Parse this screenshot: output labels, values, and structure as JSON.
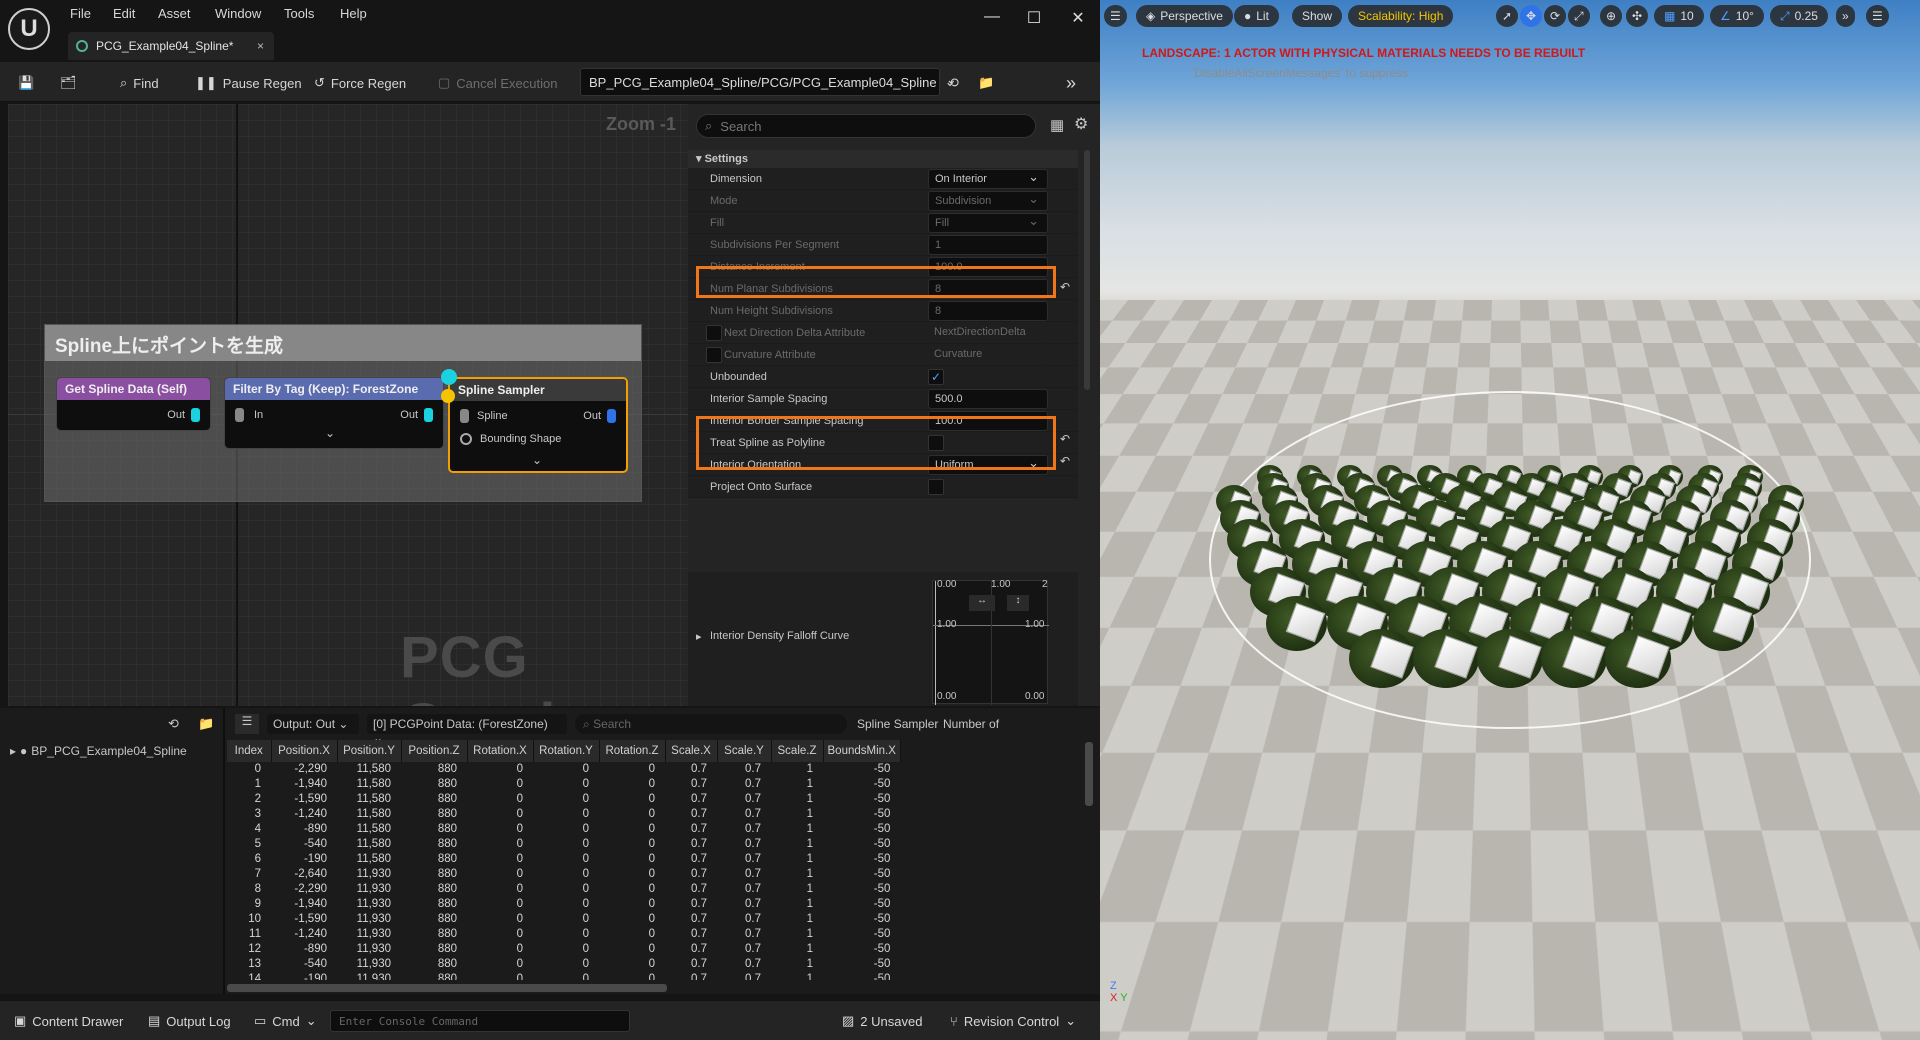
{
  "menu": [
    "File",
    "Edit",
    "Asset",
    "Window",
    "Tools",
    "Help"
  ],
  "doc_tab": {
    "title": "PCG_Example04_Spline*",
    "close": "×"
  },
  "toolbar": {
    "find": "Find",
    "pause_regen": "Pause Regen",
    "force_regen": "Force Regen",
    "cancel_execution": "Cancel Execution",
    "graph_path": "BP_PCG_Example04_Spline/PCG/PCG_Example04_Spline"
  },
  "graph": {
    "zoom": "Zoom -1",
    "watermark": "PCG Graph",
    "comment_title": "Spline上にポイントを生成",
    "nodes": {
      "get_spline": {
        "title": "Get Spline Data (Self)",
        "out": "Out",
        "color": "#8a4fa0"
      },
      "filter": {
        "title": "Filter By Tag (Keep): ForestZone",
        "in": "In",
        "out": "Out",
        "color": "#5b6bb0"
      },
      "sampler": {
        "title": "Spline Sampler",
        "spline": "Spline",
        "bounding": "Bounding Shape",
        "out": "Out",
        "color": "#3a3a3a"
      }
    }
  },
  "details": {
    "search_placeholder": "Search",
    "section": "Settings",
    "rows": [
      {
        "label": "Dimension",
        "value": "On Interior",
        "type": "combo",
        "dim": false
      },
      {
        "label": "Mode",
        "value": "Subdivision",
        "type": "combo",
        "dim": true
      },
      {
        "label": "Fill",
        "value": "Fill",
        "type": "combo",
        "dim": true
      },
      {
        "label": "Subdivisions Per Segment",
        "value": "1",
        "type": "text",
        "dim": true
      },
      {
        "label": "Distance Increment",
        "value": "100.0",
        "type": "text",
        "dim": true
      },
      {
        "label": "Num Planar Subdivisions",
        "value": "8",
        "type": "text",
        "dim": true
      },
      {
        "label": "Num Height Subdivisions",
        "value": "8",
        "type": "text",
        "dim": true
      },
      {
        "label": "Next Direction Delta Attribute",
        "value": "NextDirectionDelta",
        "type": "checktext",
        "dim": true
      },
      {
        "label": "Curvature Attribute",
        "value": "Curvature",
        "type": "checktext",
        "dim": true
      },
      {
        "label": "Unbounded",
        "value": "",
        "type": "check-on",
        "dim": false
      },
      {
        "label": "Interior Sample Spacing",
        "value": "500.0",
        "type": "text",
        "dim": false
      },
      {
        "label": "Interior Border Sample Spacing",
        "value": "100.0",
        "type": "text",
        "dim": false
      },
      {
        "label": "Treat Spline as Polyline",
        "value": "",
        "type": "check",
        "dim": false
      },
      {
        "label": "Interior Orientation",
        "value": "Uniform",
        "type": "combo",
        "dim": false
      },
      {
        "label": "Project Onto Surface",
        "value": "",
        "type": "check",
        "dim": false
      }
    ],
    "curve": {
      "label": "Interior Density Falloff Curve",
      "x0": "0.00",
      "x1": "1.00",
      "x2": "2",
      "y_top_left": "1.00",
      "y_top_right": "1.00",
      "y_bottom_left": "0.00",
      "y_bottom_right": "0.00"
    }
  },
  "outline": {
    "item": "BP_PCG_Example04_Spline"
  },
  "data_view": {
    "output": "Output: Out",
    "data": "[0] PCGPoint Data: (ForestZone)",
    "search_placeholder": "Search",
    "node_label": "Spline Sampler",
    "count_label": "Number of",
    "columns": [
      "Index",
      "Position.X",
      "Position.Y",
      "Position.Z",
      "Rotation.X",
      "Rotation.Y",
      "Rotation.Z",
      "Scale.X",
      "Scale.Y",
      "Scale.Z",
      "BoundsMin.X"
    ],
    "rows": [
      [
        "0",
        "-2,290",
        "11,580",
        "880",
        "0",
        "0",
        "0",
        "0.7",
        "0.7",
        "1",
        "-50"
      ],
      [
        "1",
        "-1,940",
        "11,580",
        "880",
        "0",
        "0",
        "0",
        "0.7",
        "0.7",
        "1",
        "-50"
      ],
      [
        "2",
        "-1,590",
        "11,580",
        "880",
        "0",
        "0",
        "0",
        "0.7",
        "0.7",
        "1",
        "-50"
      ],
      [
        "3",
        "-1,240",
        "11,580",
        "880",
        "0",
        "0",
        "0",
        "0.7",
        "0.7",
        "1",
        "-50"
      ],
      [
        "4",
        "-890",
        "11,580",
        "880",
        "0",
        "0",
        "0",
        "0.7",
        "0.7",
        "1",
        "-50"
      ],
      [
        "5",
        "-540",
        "11,580",
        "880",
        "0",
        "0",
        "0",
        "0.7",
        "0.7",
        "1",
        "-50"
      ],
      [
        "6",
        "-190",
        "11,580",
        "880",
        "0",
        "0",
        "0",
        "0.7",
        "0.7",
        "1",
        "-50"
      ],
      [
        "7",
        "-2,640",
        "11,930",
        "880",
        "0",
        "0",
        "0",
        "0.7",
        "0.7",
        "1",
        "-50"
      ],
      [
        "8",
        "-2,290",
        "11,930",
        "880",
        "0",
        "0",
        "0",
        "0.7",
        "0.7",
        "1",
        "-50"
      ],
      [
        "9",
        "-1,940",
        "11,930",
        "880",
        "0",
        "0",
        "0",
        "0.7",
        "0.7",
        "1",
        "-50"
      ],
      [
        "10",
        "-1,590",
        "11,930",
        "880",
        "0",
        "0",
        "0",
        "0.7",
        "0.7",
        "1",
        "-50"
      ],
      [
        "11",
        "-1,240",
        "11,930",
        "880",
        "0",
        "0",
        "0",
        "0.7",
        "0.7",
        "1",
        "-50"
      ],
      [
        "12",
        "-890",
        "11,930",
        "880",
        "0",
        "0",
        "0",
        "0.7",
        "0.7",
        "1",
        "-50"
      ],
      [
        "13",
        "-540",
        "11,930",
        "880",
        "0",
        "0",
        "0",
        "0.7",
        "0.7",
        "1",
        "-50"
      ],
      [
        "14",
        "-190",
        "11,930",
        "880",
        "0",
        "0",
        "0",
        "0.7",
        "0.7",
        "1",
        "-50"
      ]
    ]
  },
  "statusbar": {
    "content_drawer": "Content Drawer",
    "output_log": "Output Log",
    "cmd": "Cmd",
    "console_placeholder": "Enter Console Command",
    "unsaved": "2 Unsaved",
    "revision_control": "Revision Control"
  },
  "viewport": {
    "perspective": "Perspective",
    "lit": "Lit",
    "show": "Show",
    "scalability": "Scalability: High",
    "grid": "10",
    "angle": "10°",
    "scale": "0.25",
    "warning": "LANDSCAPE: 1 ACTOR WITH PHYSICAL MATERIALS NEEDS TO BE REBUILT",
    "suppress": "'DisableAllScreenMessages' to suppress"
  },
  "colors": {
    "highlight": "#f0761a",
    "accent_cyan": "#1ad2e0",
    "accent_yellow": "#f5c400",
    "warning_red": "#d01818"
  }
}
